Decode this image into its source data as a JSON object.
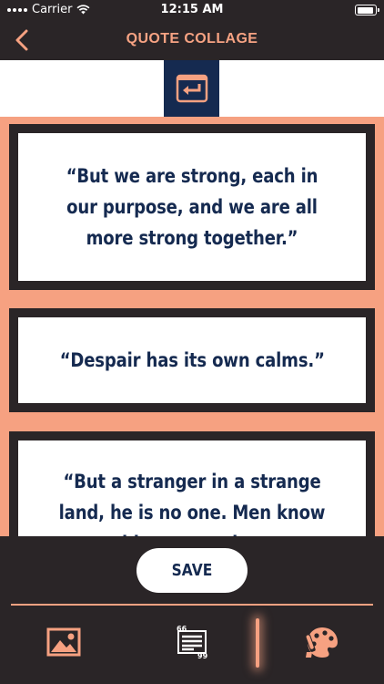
{
  "status_bar": {
    "carrier": "Carrier",
    "time": "12:15 AM"
  },
  "nav": {
    "title": "QUOTE COLLAGE"
  },
  "quotes": [
    "“But we are strong, each in our purpose, and we are all more strong together.”",
    "“Despair has its own calms.”",
    "“But a stranger in a strange land, he is no one. Men know him not, and to"
  ],
  "actions": {
    "save_label": "SAVE"
  },
  "tabs": {
    "image_icon": "image-icon",
    "text_icon": "quote-text-icon",
    "text_icon_top": "66",
    "text_icon_bottom": "99",
    "style_icon": "palette-brush-icon",
    "active_indicator_after": "text"
  },
  "colors": {
    "background": "#2a2527",
    "accent": "#f6a181",
    "navy": "#152a50",
    "white": "#ffffff"
  }
}
